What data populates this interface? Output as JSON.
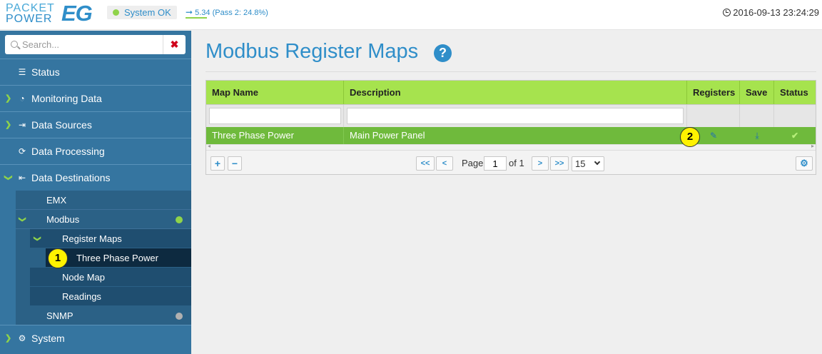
{
  "header": {
    "logo_line1": "PACKET",
    "logo_line2": "POWER",
    "logo_eg": "EG",
    "system_status": "System OK",
    "version_text": "5.34 (Pass 2: 24.8%)",
    "datetime": "2016-09-13 23:24:29",
    "status_color": "#8fd34a",
    "accent_color": "#2f8ec9"
  },
  "sidebar": {
    "search_placeholder": "Search...",
    "clear_icon": "close-icon",
    "items": [
      {
        "label": "Status",
        "icon": "list-icon",
        "expanded": false
      },
      {
        "label": "Monitoring Data",
        "icon": "dashboard-icon",
        "expanded": false
      },
      {
        "label": "Data Sources",
        "icon": "sign-in-icon",
        "expanded": false
      },
      {
        "label": "Data Processing",
        "icon": "refresh-icon",
        "expanded": false
      },
      {
        "label": "Data Destinations",
        "icon": "sign-out-icon",
        "expanded": true
      },
      {
        "label": "System",
        "icon": "gear-icon",
        "expanded": false
      }
    ],
    "destinations": {
      "emx": "EMX",
      "modbus": "Modbus",
      "modbus_status_color": "#8fd34a",
      "register_maps": "Register Maps",
      "three_phase_power": "Three Phase Power",
      "node_map": "Node Map",
      "readings": "Readings",
      "snmp": "SNMP",
      "snmp_status_color": "#b0b0b0"
    }
  },
  "callouts": {
    "first": "1",
    "second": "2"
  },
  "main": {
    "title": "Modbus Register Maps",
    "grid": {
      "columns": [
        "Map Name",
        "Description",
        "Registers",
        "Save",
        "Status"
      ],
      "rows": [
        {
          "map_name": "Three Phase Power",
          "description": "Main Power Panel",
          "registers_icon": "pencil-icon",
          "save_icon": "download-icon",
          "status_icon": "check-icon"
        }
      ],
      "pager": {
        "first": "<<",
        "prev": "<",
        "page_label": "Page",
        "page_value": "1",
        "of_label": "of 1",
        "next": ">",
        "last": ">>",
        "page_size": "15",
        "add": "+",
        "remove": "−"
      }
    }
  }
}
